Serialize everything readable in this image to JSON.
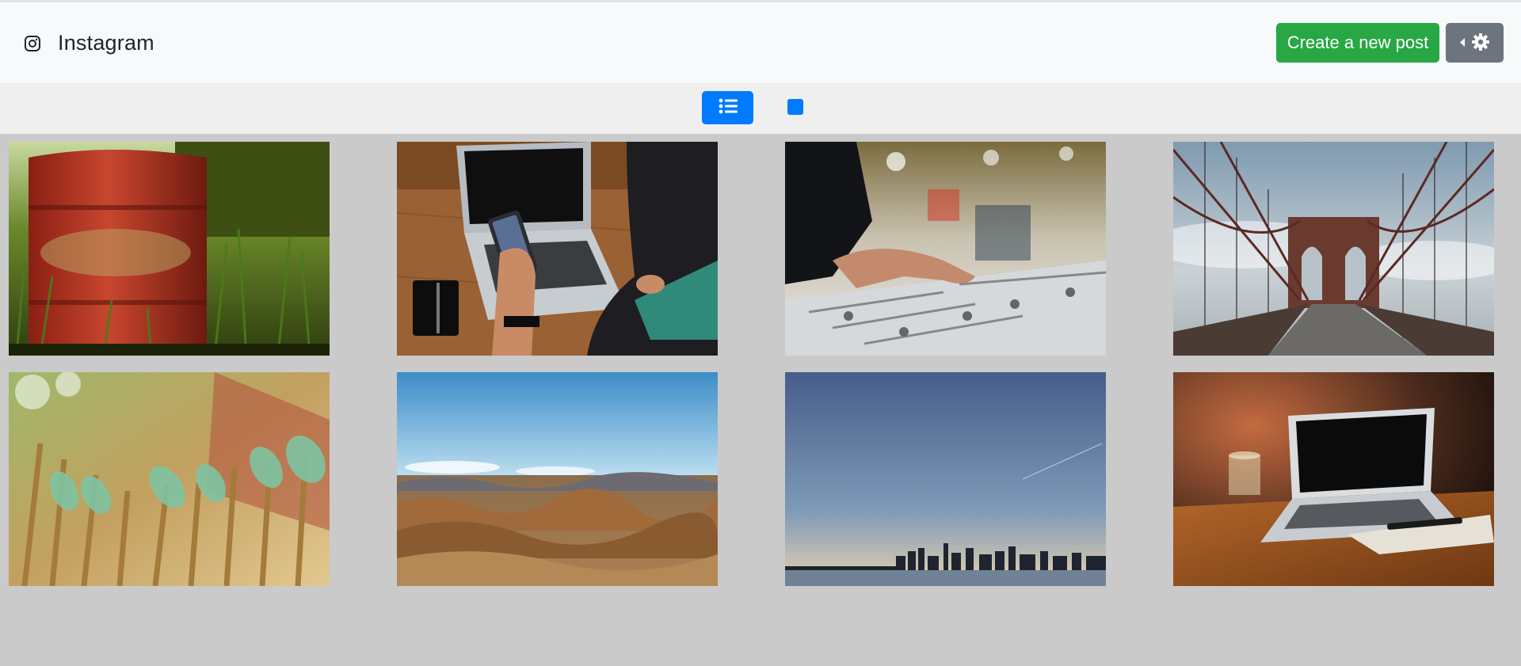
{
  "brand": {
    "name": "Instagram",
    "icon": "instagram-icon"
  },
  "header": {
    "create_post_label": "Create a new post",
    "settings_icons": [
      "caret-left-icon",
      "gear-icon"
    ]
  },
  "view_toggle": {
    "active": "list",
    "options": [
      "list-icon",
      "square-icon"
    ]
  },
  "colors": {
    "navbar_bg": "#f8f9fa",
    "toolbar_bg": "#efefef",
    "page_bg": "#cacaca",
    "create_button": "#28a745",
    "settings_button": "#6c757d",
    "view_toggle": "#007bff"
  },
  "photos": [
    {
      "subject": "rusty red barrel in tall grass"
    },
    {
      "subject": "person holding phone at laptop on wooden desk"
    },
    {
      "subject": "hand on audio mixing console"
    },
    {
      "subject": "brooklyn bridge cables and tower"
    },
    {
      "subject": "green glass bottles on wooden fence"
    },
    {
      "subject": "rolling brown hills under blue sky"
    },
    {
      "subject": "city skyline across the bay at dusk"
    },
    {
      "subject": "laptop on wooden table with glass"
    }
  ]
}
